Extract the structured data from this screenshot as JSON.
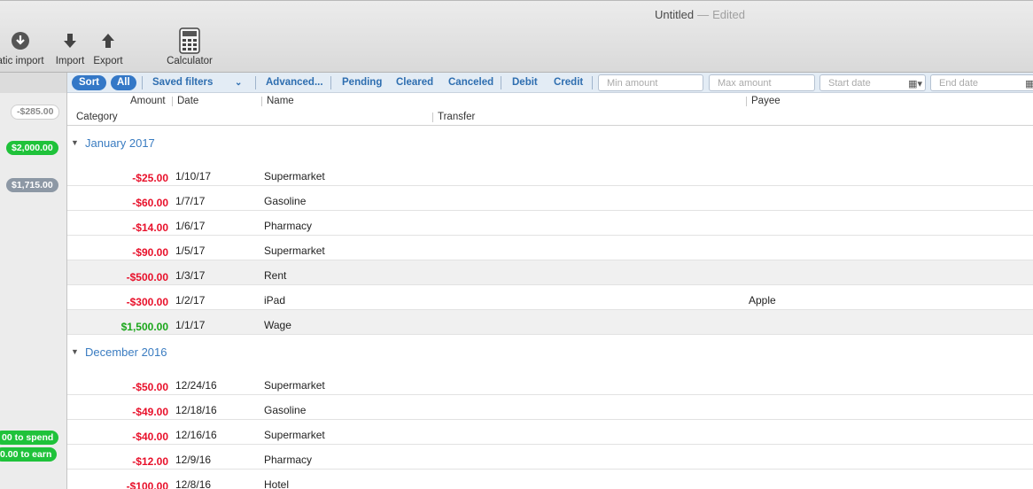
{
  "window": {
    "title": "Untitled",
    "separator": "—",
    "status": "Edited"
  },
  "toolbar": {
    "auto_import_label": "atic import",
    "import_label": "Import",
    "export_label": "Export",
    "calculator_label": "Calculator"
  },
  "sidebar": {
    "balances": [
      "-$285.00",
      "$2,000.00",
      "$1,715.00"
    ],
    "to_spend": "00 to spend",
    "to_earn": "0.00 to earn"
  },
  "filters": {
    "sort": "Sort",
    "all": "All",
    "saved_filters": "Saved filters",
    "advanced": "Advanced...",
    "pending": "Pending",
    "cleared": "Cleared",
    "canceled": "Canceled",
    "debit": "Debit",
    "credit": "Credit",
    "min_amount_placeholder": "Min amount",
    "max_amount_placeholder": "Max amount",
    "start_date_placeholder": "Start date",
    "end_date_placeholder": "End date"
  },
  "columns": {
    "amount": "Amount",
    "date": "Date",
    "name": "Name",
    "payee": "Payee",
    "category": "Category",
    "transfer": "Transfer"
  },
  "groups": [
    {
      "title": "January 2017",
      "rows": [
        {
          "amount": "-$25.00",
          "date": "1/10/17",
          "name": "Supermarket",
          "payee": ""
        },
        {
          "amount": "-$60.00",
          "date": "1/7/17",
          "name": "Gasoline",
          "payee": ""
        },
        {
          "amount": "-$14.00",
          "date": "1/6/17",
          "name": "Pharmacy",
          "payee": ""
        },
        {
          "amount": "-$90.00",
          "date": "1/5/17",
          "name": "Supermarket",
          "payee": ""
        },
        {
          "amount": "-$500.00",
          "date": "1/3/17",
          "name": "Rent",
          "payee": ""
        },
        {
          "amount": "-$300.00",
          "date": "1/2/17",
          "name": "iPad",
          "payee": "Apple"
        },
        {
          "amount": "$1,500.00",
          "date": "1/1/17",
          "name": "Wage",
          "payee": ""
        }
      ]
    },
    {
      "title": "December 2016",
      "rows": [
        {
          "amount": "-$50.00",
          "date": "12/24/16",
          "name": "Supermarket",
          "payee": ""
        },
        {
          "amount": "-$49.00",
          "date": "12/18/16",
          "name": "Gasoline",
          "payee": ""
        },
        {
          "amount": "-$40.00",
          "date": "12/16/16",
          "name": "Supermarket",
          "payee": ""
        },
        {
          "amount": "-$12.00",
          "date": "12/9/16",
          "name": "Pharmacy",
          "payee": ""
        },
        {
          "amount": "-$100.00",
          "date": "12/8/16",
          "name": "Hotel",
          "payee": ""
        }
      ]
    }
  ],
  "colors": {
    "negative": "#e8102a",
    "positive": "#1aa61a",
    "accent": "#3478c7",
    "group_title": "#3a7cc1"
  }
}
